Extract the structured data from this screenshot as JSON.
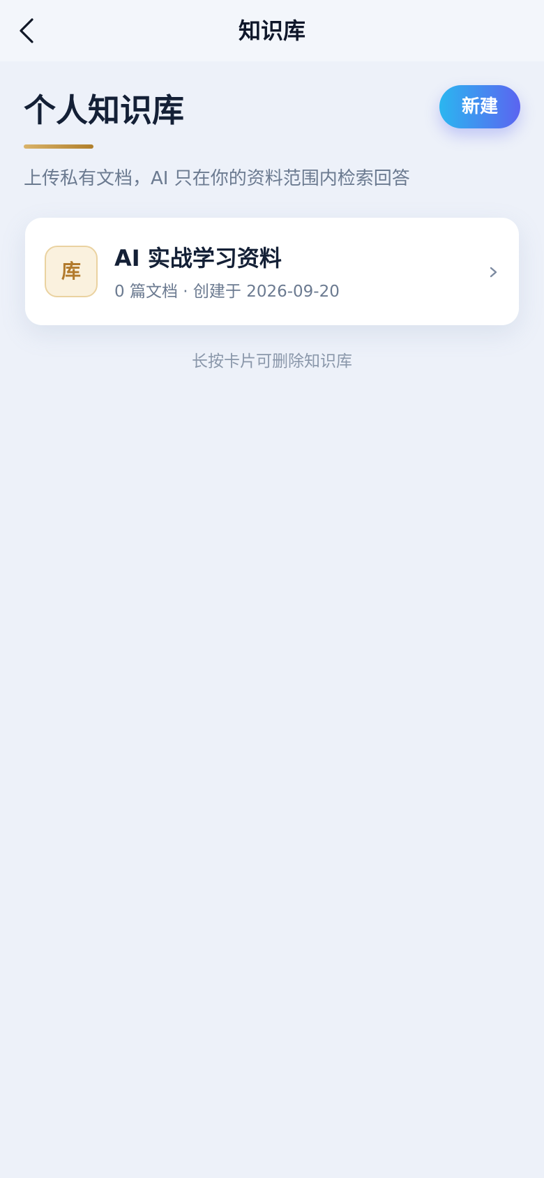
{
  "navbar": {
    "title": "知识库",
    "back_icon": "chevron-left-icon"
  },
  "header": {
    "title": "个人知识库",
    "new_button_label": "新建",
    "subtitle": "上传私有文档，AI 只在你的资料范围内检索回答"
  },
  "knowledge_bases": [
    {
      "avatar_text": "库",
      "name": "AI 实战学习资料",
      "meta": "0 篇文档 · 创建于 2026-09-20",
      "chevron_icon": "chevron-right-icon"
    }
  ],
  "hint": "长按卡片可删除知识库",
  "colors": {
    "background": "#edf1f9",
    "accent_gradient_start": "#2bb6f0",
    "accent_gradient_end": "#5b64f0",
    "gold": "#b27a2c"
  }
}
